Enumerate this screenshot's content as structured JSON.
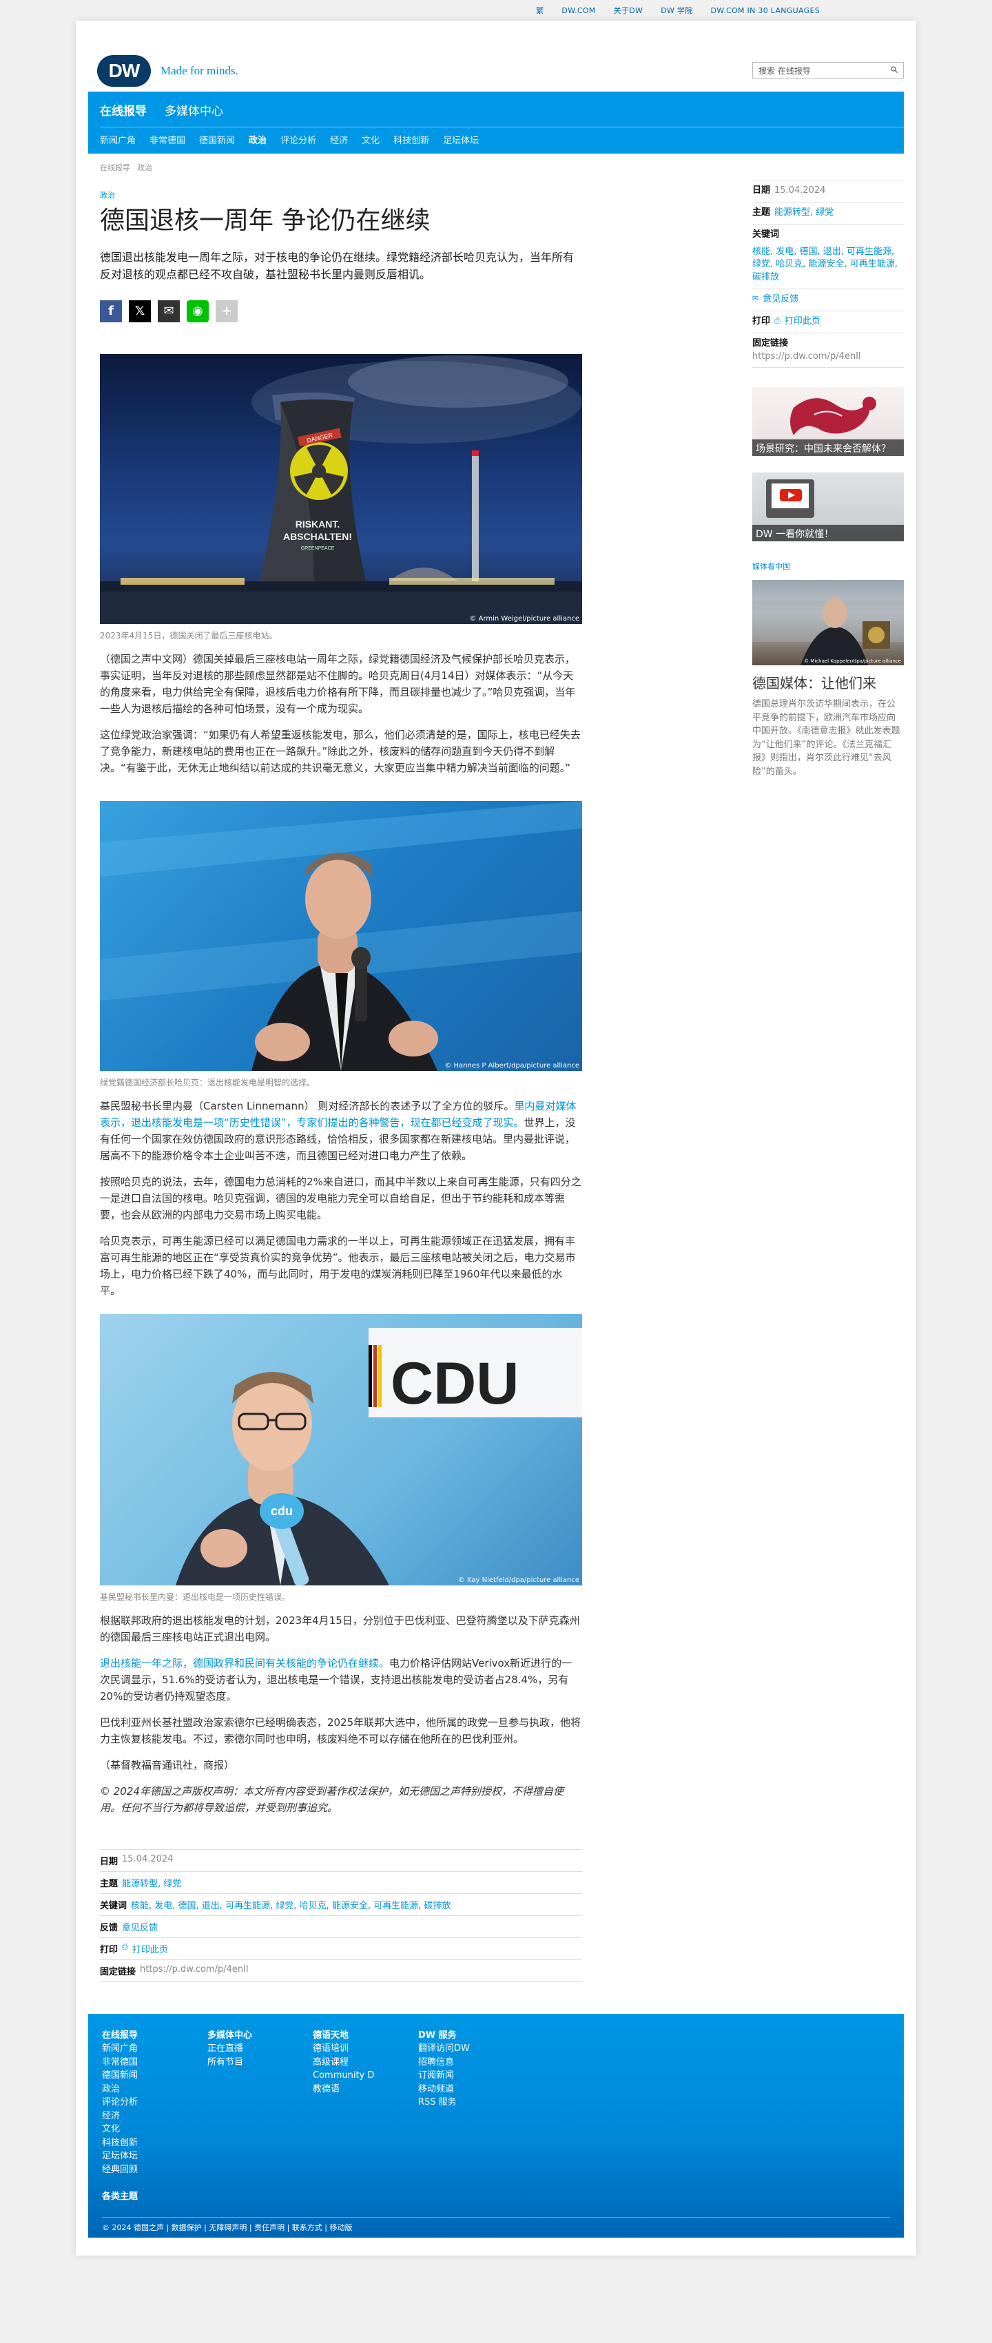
{
  "topbar": [
    "繁",
    "DW.COM",
    "关于DW",
    "DW 学院",
    "DW.COM IN 30 LANGUAGES"
  ],
  "logo": {
    "badge": "DW",
    "tagline": "Made for minds."
  },
  "search": {
    "placeholder": "搜索 在线报导"
  },
  "nav": {
    "main": [
      "在线报导",
      "多媒体中心"
    ],
    "sub": [
      "新闻广角",
      "非常德国",
      "德国新闻",
      "政治",
      "评论分析",
      "经济",
      "文化",
      "科技创新",
      "足坛体坛"
    ]
  },
  "breadcrumb": [
    "在线报导",
    "政治"
  ],
  "article": {
    "kicker": "政治",
    "title": "德国退核一周年 争论仍在继续",
    "teaser": "德国退出核能发电一周年之际，对于核电的争论仍在继续。绿党籍经济部长哈贝克认为，当年所有反对退核的观点都已经不攻自破，基社盟秘书长里内曼则反唇相讥。",
    "photo1": {
      "caption": "2023年4月15日，德国关闭了最后三座核电站。",
      "credit": "© Armin Weigel/picture alliance",
      "projection_top": "DANGER",
      "projection_line1": "RISKANT.",
      "projection_line2": "ABSCHALTEN!",
      "projection_brand": "GREENPEACE"
    },
    "p1": "（德国之声中文网）德国关掉最后三座核电站一周年之际，绿党籍德国经济及气候保护部长哈贝克表示，事实证明，当年反对退核的那些顾虑显然都是站不住脚的。哈贝克周日(4月14日）对媒体表示：“从今天的角度来看，电力供给完全有保障，退核后电力价格有所下降，而且碳排量也减少了。”哈贝克强调，当年一些人为退核后描绘的各种可怕场景，没有一个成为现实。",
    "p2": "这位绿党政治家强调：“如果仍有人希望重返核能发电，那么，他们必须清楚的是，国际上，核电已经失去了竞争能力，新建核电站的费用也正在一路飙升。”除此之外，核废料的储存问题直到今天仍得不到解决。“有鉴于此，无休无止地纠结以前达成的共识毫无意义，大家更应当集中精力解决当前面临的问题。”",
    "photo2": {
      "caption": "绿党籍德国经济部长哈贝克：退出核能发电是明智的选择。",
      "credit": "© Hannes P Albert/dpa/picture alliance"
    },
    "p3a": "基民盟秘书长里内曼（Carsten Linnemann） 则对经济部长的表述予以了全方位的驳斥。",
    "p3link": "里内曼对媒体表示，退出核能发电是一项“历史性错误”，专家们提出的各种警告，现在都已经变成了现实。",
    "p3b": "世界上，没有任何一个国家在效仿德国政府的意识形态路线，恰恰相反，很多国家都在新建核电站。里内曼批评说，居高不下的能源价格令本土企业叫苦不迭，而且德国已经对进口电力产生了依赖。",
    "p4": "按照哈贝克的说法，去年，德国电力总消耗的2%来自进口，而其中半数以上来自可再生能源，只有四分之一是进口自法国的核电。哈贝克强调，德国的发电能力完全可以自给自足，但出于节约能耗和成本等需要，也会从欧洲的内部电力交易市场上购买电能。",
    "p5": "哈贝克表示，可再生能源已经可以满足德国电力需求的一半以上，可再生能源领域正在迅猛发展，拥有丰富可再生能源的地区正在“享受货真价实的竞争优势”。他表示，最后三座核电站被关闭之后，电力交易市场上，电力价格已经下跌了40%，而与此同时，用于发电的煤炭消耗则已降至1960年代以来最低的水平。",
    "photo3": {
      "caption": "基民盟秘书长里内曼：退出核电是一项历史性错误。",
      "credit": "© Kay Nietfeld/dpa/picture alliance",
      "sign": "CDU",
      "mic": "cdu"
    },
    "p6": "根据联邦政府的退出核能发电的计划，2023年4月15日，分别位于巴伐利亚、巴登符腾堡以及下萨克森州的德国最后三座核电站正式退出电网。",
    "p7link": "退出核能一年之际，德国政界和民间有关核能的争论仍在继续。",
    "p7": "电力价格评估网站Verivox新近进行的一次民调显示，51.6%的受访者认为，退出核电是一个错误，支持退出核能发电的受访者占28.4%，另有20%的受访者仍持观望态度。",
    "p8": "巴伐利亚州长基社盟政治家索德尔已经明确表态，2025年联邦大选中，他所属的政党一旦参与执政，他将力主恢复核能发电。不过，索德尔同时也申明，核废料绝不可以存储在他所在的巴伐利亚州。",
    "p9": "（基督教福音通讯社，商报）",
    "disclaimer": "© 2024年德国之声版权声明：本文所有内容受到著作权法保护，如无德国之声特别授权，不得擅自使用。任何不当行为都将导致追偿，并受到刑事追究。"
  },
  "meta": {
    "date_label": "日期",
    "date": "15.04.2024",
    "topic_label": "主题",
    "topics": "能源转型, 绿党",
    "keywords_label": "关键词",
    "keywords": "核能, 发电, 德国, 退出, 可再生能源, 绿党, 哈贝克, 能源安全, 可再生能源, 碳排放",
    "feedback_label": "反馈",
    "feedback": "意见反馈",
    "print_label": "打印",
    "print": "打印此页",
    "permalink_label": "固定链接",
    "permalink": "https://p.dw.com/p/4enIl"
  },
  "aside": {
    "feedback": "意见反馈",
    "thumb1": "场景研究：中国未来会否解体？",
    "thumb2": "DW 一看你就懂！",
    "media_label": "媒体看中国",
    "article_title": "德国媒体：让他们来",
    "article_text": "德国总理肖尔茨访华期间表示，在公平竞争的前提下，欧洲汽车市场应向中国开放。《南德意志报》就此发表题为“让他们来”的评论。《法兰克福汇报》则指出，肖尔茨此行难见“去风险”的苗头。",
    "img_credit": "© Michael Kappeler/dpa/picture alliance"
  },
  "footer": {
    "cols": [
      {
        "title": "在线报导",
        "items": [
          "新闻广角",
          "非常德国",
          "德国新闻",
          "政治",
          "评论分析",
          "经济",
          "文化",
          "科技创新",
          "足坛体坛",
          "经典回顾"
        ]
      },
      {
        "title": "多媒体中心",
        "items": [
          "正在直播",
          "所有节目"
        ]
      },
      {
        "title": "德语天地",
        "items": [
          "德语培训",
          "高级课程",
          "Community D",
          "教德语"
        ]
      },
      {
        "title": "DW 服务",
        "items": [
          "翻译访问DW",
          "招聘信息",
          "订阅新闻",
          "移动频道",
          "RSS 服务"
        ]
      }
    ],
    "misc": "各类主题",
    "bottom": "© 2024 德国之声 | 数据保护 | 无障碍声明 | 责任声明 | 联系方式 | 移动版"
  }
}
